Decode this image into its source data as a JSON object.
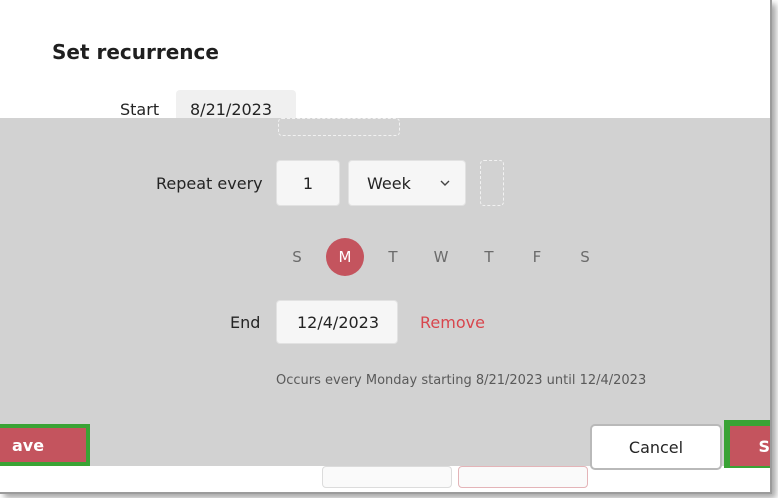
{
  "dialog": {
    "title": "Set recurrence",
    "start_label": "Start",
    "start_value": "8/21/2023",
    "repeat_label": "Repeat every",
    "repeat_count": "1",
    "repeat_unit": "Week",
    "days": [
      {
        "label": "S",
        "selected": false
      },
      {
        "label": "M",
        "selected": true
      },
      {
        "label": "T",
        "selected": false
      },
      {
        "label": "W",
        "selected": false
      },
      {
        "label": "T",
        "selected": false
      },
      {
        "label": "F",
        "selected": false
      },
      {
        "label": "S",
        "selected": false
      }
    ],
    "end_label": "End",
    "end_value": "12/4/2023",
    "remove_label": "Remove",
    "summary": "Occurs every Monday starting 8/21/2023 until 12/4/2023"
  },
  "buttons": {
    "save_left_label": "ave",
    "cancel_label": "Cancel",
    "save_right_label": "S"
  },
  "icons": {
    "dropdown": "chevron-down-icon"
  },
  "colors": {
    "accent": "#c4545e",
    "highlight": "#3aa335",
    "overlay": "#d2d2d2",
    "link": "#d8464d"
  }
}
